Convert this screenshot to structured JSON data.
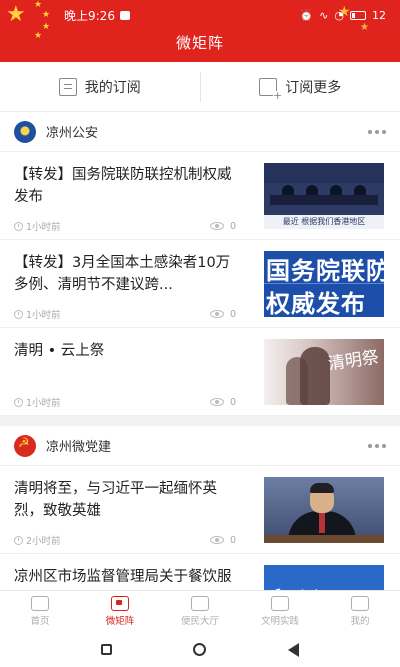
{
  "status_bar": {
    "time": "晚上9:26",
    "battery": "12"
  },
  "header": {
    "title": "微矩阵"
  },
  "subscription": {
    "my_label": "我的订阅",
    "more_label": "订阅更多"
  },
  "sections": [
    {
      "name": "凉州公安",
      "articles": [
        {
          "title": "【转发】国务院联防联控机制权威发布",
          "time": "1小时前",
          "views": "0",
          "thumb_caption": "最近 根据我们香港地区"
        },
        {
          "title": "【转发】3月全国本土感染者10万多例、清明节不建议跨...",
          "time": "1小时前",
          "views": "0",
          "thumb_line1": "国务院联防",
          "thumb_line2": "权威发布"
        },
        {
          "title": "清明 • 云上祭",
          "time": "1小时前",
          "views": "0",
          "thumb_text": "清明祭"
        }
      ]
    },
    {
      "name": "凉州微党建",
      "articles": [
        {
          "title": "清明将至，与习近平一起缅怀英烈，致敬英雄",
          "time": "2小时前",
          "views": "0"
        },
        {
          "title": "凉州区市场监督管理局关于餐饮服务单位全面落实“六凉...",
          "thumb_text": "新闻"
        }
      ]
    }
  ],
  "bottom_nav": [
    {
      "label": "首页",
      "active": false
    },
    {
      "label": "微矩阵",
      "active": true
    },
    {
      "label": "便民大厅",
      "active": false
    },
    {
      "label": "文明实践",
      "active": false
    },
    {
      "label": "我的",
      "active": false
    }
  ],
  "colors": {
    "brand_red": "#e0231d",
    "active_nav": "#d9231c",
    "star_gold": "#ffd23c"
  }
}
